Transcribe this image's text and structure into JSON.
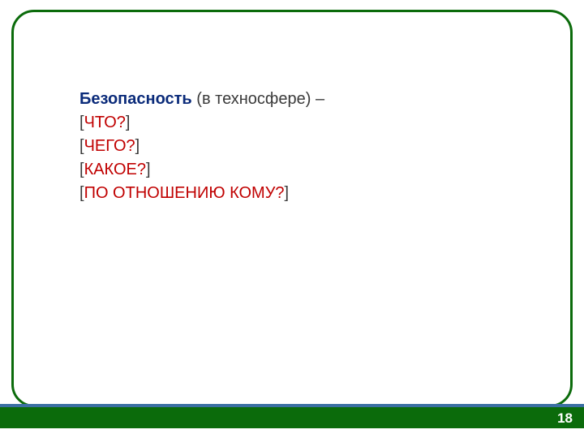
{
  "title": {
    "word": "Безопасность",
    "rest": " (в техносфере) –"
  },
  "lines": [
    {
      "open": "[",
      "q": "ЧТО?",
      "close": "]"
    },
    {
      "open": "[",
      "q": "ЧЕГО?",
      "close": "]"
    },
    {
      "open": "[",
      "q": "КАКОЕ?",
      "close": "]"
    },
    {
      "open": "[",
      "q": "ПО ОТНОШЕНИЮ КОМУ?",
      "close": "]"
    }
  ],
  "pageNumber": "18"
}
